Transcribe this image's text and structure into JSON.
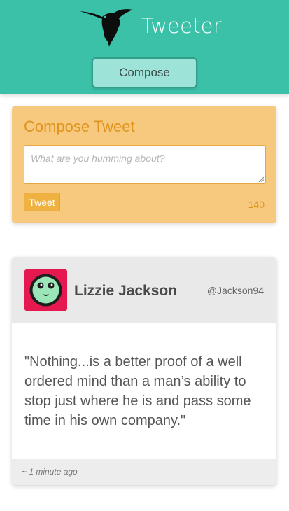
{
  "header": {
    "brand": "Tweeter",
    "compose_button": "Compose",
    "logo_icon": "hummingbird-icon",
    "bg_color": "#3cc1a9"
  },
  "compose": {
    "title": "Compose Tweet",
    "placeholder": "What are you humming about?",
    "tweet_button": "Tweet",
    "counter": "140",
    "bg_color": "#f6c97e"
  },
  "tweet": {
    "author_name": "Lizzie Jackson",
    "handle": "@Jackson94",
    "body": "\"Nothing...is a better proof of a well ordered mind than a man’s ability to stop just where he is and pass some time in his own company.\"",
    "timestamp": "~ 1 minute ago",
    "avatar_icon": "smiley-avatar-icon"
  }
}
